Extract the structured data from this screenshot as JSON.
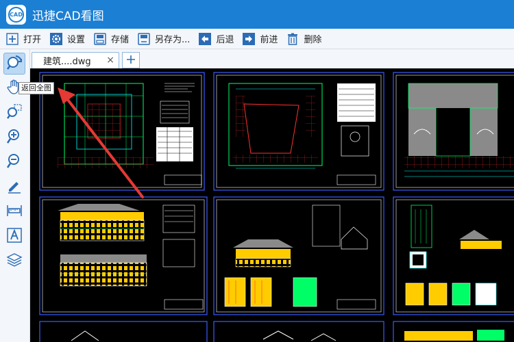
{
  "app": {
    "title": "迅捷CAD看图",
    "logo_text": "CAD"
  },
  "toolbar": {
    "open": "打开",
    "settings": "设置",
    "save": "存储",
    "save_as": "另存为...",
    "back": "后退",
    "forward": "前进",
    "delete": "删除"
  },
  "tabs": {
    "doc_name": "建筑....dwg",
    "close_symbol": "×"
  },
  "tooltip": {
    "text": "返回全图"
  },
  "left_tools": [
    "fit-all",
    "pan",
    "zoom-window",
    "zoom-in",
    "zoom-out",
    "pen",
    "measure",
    "text",
    "layers"
  ],
  "colors": {
    "titlebar": "#1b7fd4",
    "canvas": "#000000",
    "highlight": "#bcd9f4",
    "arrow": "#e53935"
  }
}
